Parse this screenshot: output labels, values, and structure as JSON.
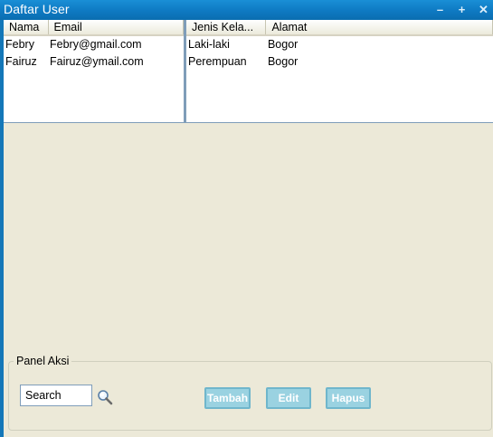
{
  "window": {
    "title": "Daftar User",
    "controls": {
      "minimize": "–",
      "maximize": "+",
      "close": "✕"
    }
  },
  "table_left": {
    "headers": [
      "Nama",
      "Email"
    ],
    "rows": [
      [
        "Febry",
        "Febry@gmail.com"
      ],
      [
        "Fairuz",
        "Fairuz@ymail.com"
      ]
    ]
  },
  "table_right": {
    "headers": [
      "Jenis Kela...",
      "Alamat"
    ],
    "rows": [
      [
        "Laki-laki",
        "Bogor"
      ],
      [
        "Perempuan",
        "Bogor"
      ]
    ]
  },
  "panel": {
    "title": "Panel Aksi",
    "search_value": "Search",
    "buttons": {
      "tambah": "Tambah",
      "edit": "Edit",
      "hapus": "Hapus"
    }
  },
  "colors": {
    "titlebar": "#0f7bc4",
    "background": "#ece9d8",
    "button": "#9ad2e1"
  }
}
